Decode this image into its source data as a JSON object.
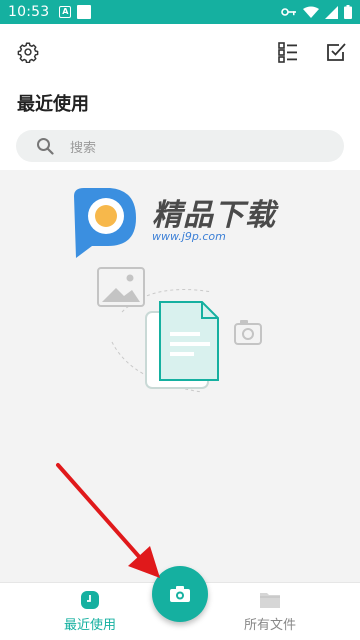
{
  "status_bar": {
    "time": "10:53",
    "notif_a": "A"
  },
  "header": {
    "title": "最近使用"
  },
  "search": {
    "placeholder": "搜索"
  },
  "watermark": {
    "brand": "精品下载",
    "url": "www.j9p.com"
  },
  "bottom_nav": {
    "recent_label": "最近使用",
    "files_label": "所有文件"
  },
  "colors": {
    "accent": "#15b0a0",
    "arrow": "#e0191b",
    "inactive": "#888888"
  }
}
